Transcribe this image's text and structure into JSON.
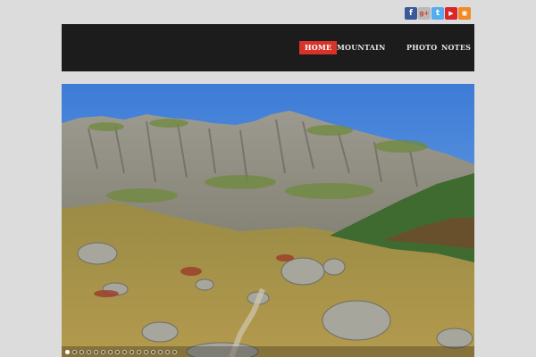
{
  "social": [
    {
      "name": "facebook-icon",
      "glyph": "f",
      "color": "#3b5998"
    },
    {
      "name": "google-plus-icon",
      "glyph": "g+",
      "color": "#c1c1c1"
    },
    {
      "name": "twitter-icon",
      "glyph": "t",
      "color": "#55acee"
    },
    {
      "name": "youtube-icon",
      "glyph": "▶",
      "color": "#d9262a"
    },
    {
      "name": "rss-icon",
      "glyph": "◉",
      "color": "#f08a24"
    }
  ],
  "nav": {
    "home": "HOME",
    "mountain": "MOUNTAIN",
    "photo": "PHOTO",
    "notes": "NOTES"
  },
  "colors": {
    "accent": "#d7332a",
    "header_bg": "#1c1c1c",
    "page_bg": "#dcdcdc"
  },
  "slider": {
    "slide_count": 16,
    "active_index": 0
  }
}
